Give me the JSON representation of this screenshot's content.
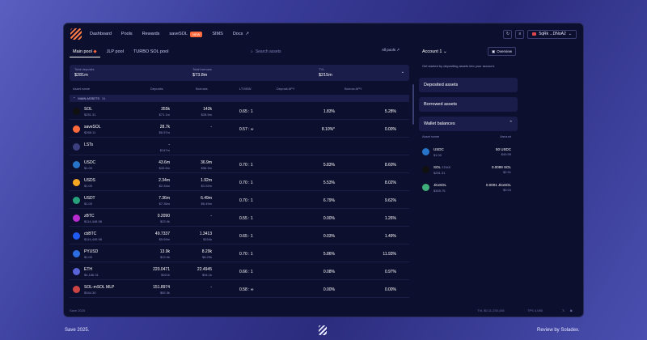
{
  "nav": {
    "items": [
      "Dashboard",
      "Pools",
      "Rewards",
      "saveSOL",
      "SIMS",
      "Docs"
    ],
    "new_badge": "NEW",
    "docs_glyph": "↗",
    "wallet_label": "5qRk ...DNoA2",
    "refresh_glyph": "↻",
    "menu_glyph": "≡"
  },
  "tabs": [
    "Main pool",
    "JLP pool",
    "TURBO SOL pool"
  ],
  "search_placeholder": "Search assets",
  "all_pools_label": "All pools",
  "summary": {
    "deposits_label": "Total deposits",
    "deposits_value": "$281m",
    "borrows_label": "Total borrows",
    "borrows_value": "$73.8m",
    "tvl_label": "TVL",
    "tvl_value": "$215m"
  },
  "table_headers": [
    "Asset name",
    "Deposits",
    "Borrows",
    "LTV/BW",
    "Deposit APY",
    "Borrow APY"
  ],
  "section_label": "MAIN ASSETS",
  "section_count": "34",
  "rows": [
    {
      "sym": "SOL",
      "price": "$251.31",
      "dep": "355k",
      "dep_usd": "$71.1m",
      "bor": "142k",
      "bor_usd": "$28.5m",
      "ltv": "0.65 : 1",
      "dapy": "1.83%",
      "bapy": "5.28%",
      "color": "#101010"
    },
    {
      "sym": "saveSOL",
      "price": "$268.11",
      "dep": "28.7k",
      "dep_usd": "$6.57m",
      "bor": "-",
      "bor_usd": "",
      "ltv": "0.57 : ∞",
      "dapy": "8.10%*",
      "bapy": "0.00%",
      "color": "#ff6a3d"
    },
    {
      "sym": "LSTs",
      "price": "",
      "dep": "-",
      "dep_usd": "$147m",
      "bor": "",
      "bor_usd": "",
      "ltv": "",
      "dapy": "",
      "bapy": "",
      "color": "#3b3f80"
    },
    {
      "sym": "USDC",
      "price": "$1.00",
      "dep": "43.6m",
      "dep_usd": "$43.6m",
      "bor": "36.9m",
      "bor_usd": "$36.9m",
      "ltv": "0.70 : 1",
      "dapy": "5.83%",
      "bapy": "8.60%",
      "color": "#2775ca"
    },
    {
      "sym": "USDS",
      "price": "$1.00",
      "dep": "2.34m",
      "dep_usd": "$2.34m",
      "bor": "1.92m",
      "bor_usd": "$1.92m",
      "ltv": "0.70 : 1",
      "dapy": "5.53%",
      "bapy": "8.02%",
      "color": "#f5a623"
    },
    {
      "sym": "USDT",
      "price": "$1.00",
      "dep": "7.36m",
      "dep_usd": "$7.36m",
      "bor": "6.49m",
      "bor_usd": "$6.49m",
      "ltv": "0.70 : 1",
      "dapy": "6.79%",
      "bapy": "9.62%",
      "color": "#26a17b"
    },
    {
      "sym": "zBTC",
      "price": "$114,448.98",
      "dep": "0.2090",
      "dep_usd": "$23.9k",
      "bor": "-",
      "bor_usd": "",
      "ltv": "0.55 : 1",
      "dapy": "0.00%",
      "bapy": "1.26%",
      "color": "#b92bd1"
    },
    {
      "sym": "cbBTC",
      "price": "$114,449.98",
      "dep": "49.7337",
      "dep_usd": "$5.69m",
      "bor": "1.3413",
      "bor_usd": "$154k",
      "ltv": "0.65 : 1",
      "dapy": "0.03%",
      "bapy": "1.49%",
      "color": "#1f5af2"
    },
    {
      "sym": "PYUSD",
      "price": "$1.00",
      "dep": "13.9k",
      "dep_usd": "$13.9k",
      "bor": "8.29k",
      "bor_usd": "$8.29k",
      "ltv": "0.70 : 1",
      "dapy": "5.86%",
      "bapy": "11.93%",
      "color": "#2d6fe0"
    },
    {
      "sym": "ETH",
      "price": "$4,186.31",
      "dep": "220.0471",
      "dep_usd": "$921k",
      "bor": "22.4945",
      "bor_usd": "$94.1k",
      "ltv": "0.66 : 1",
      "dapy": "0.08%",
      "bapy": "0.97%",
      "color": "#5a63d8"
    },
    {
      "sym": "SOL-mSOL MLP",
      "price": "$344.30",
      "dep": "151.8974",
      "dep_usd": "$52.3k",
      "bor": "-",
      "bor_usd": "",
      "ltv": "0.58 : ∞",
      "dapy": "0.00%",
      "bapy": "0.00%",
      "color": "#c44"
    }
  ],
  "sidebar": {
    "account_title": "Account 1",
    "overview_label": "Overview",
    "note": "Get started by depositing assets into your account.",
    "deposited_label": "Deposited assets",
    "borrowed_label": "Borrowed assets",
    "wallet_label": "Wallet balances",
    "wallet_headers": [
      "Asset name",
      "Amount"
    ],
    "wallet_rows": [
      {
        "sym": "USDC",
        "price": "$1.00",
        "amt": "50 USDC",
        "usd": "$49.99",
        "color": "#2775ca"
      },
      {
        "sym": "SOL",
        "tag": "STAKE",
        "price": "$251.31",
        "amt": "0.0099 SOL",
        "usd": "$2.51",
        "color": "#101010"
      },
      {
        "sym": "JitoSOL",
        "price": "$309.75",
        "amt": "0.0001 JitoSOL",
        "usd": "$0.04",
        "color": "#3fae7a"
      }
    ]
  },
  "footer": {
    "left": "Save 2025",
    "right1": "TVL $0.11,230,436",
    "right2": "TPS 4,085"
  },
  "outer": {
    "left": "Save 2025.",
    "right": "Review by Soladex."
  }
}
